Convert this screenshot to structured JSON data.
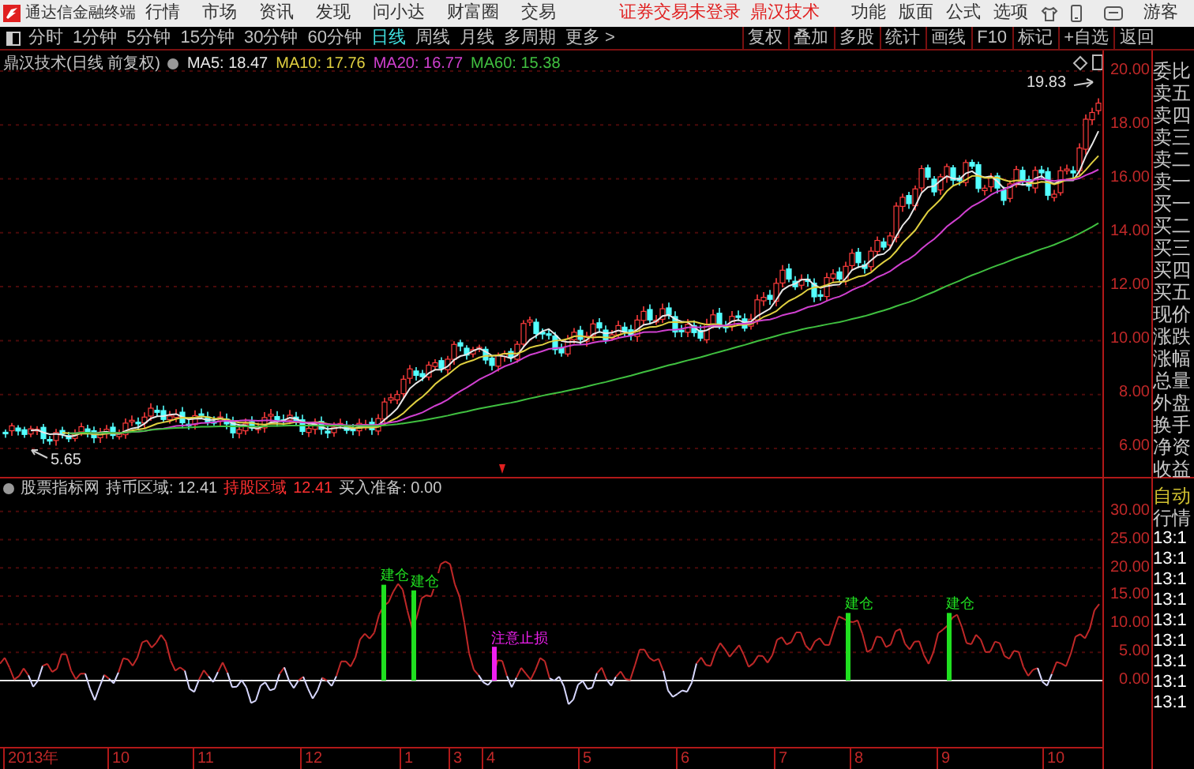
{
  "app": {
    "title": "通达信金融终端"
  },
  "menu": [
    "行情",
    "市场",
    "资讯",
    "发现",
    "问小达",
    "财富圈",
    "交易"
  ],
  "login_status": "证券交易未登录",
  "stock_name": "鼎汉技术",
  "right_menu": [
    "功能",
    "版面",
    "公式",
    "选项"
  ],
  "user": "游客",
  "periods": [
    {
      "label": "分时",
      "selected": false
    },
    {
      "label": "1分钟",
      "selected": false
    },
    {
      "label": "5分钟",
      "selected": false
    },
    {
      "label": "15分钟",
      "selected": false
    },
    {
      "label": "30分钟",
      "selected": false
    },
    {
      "label": "60分钟",
      "selected": false
    },
    {
      "label": "日线",
      "selected": true
    },
    {
      "label": "周线",
      "selected": false
    },
    {
      "label": "月线",
      "selected": false
    },
    {
      "label": "多周期",
      "selected": false
    }
  ],
  "more": "更多 >",
  "tools": [
    "复权",
    "叠加",
    "多股",
    "统计",
    "画线",
    "F10",
    "标记",
    "+自选",
    "返回"
  ],
  "chart": {
    "title": "鼎汉技术(日线 前复权)",
    "ma": [
      {
        "label": "MA5: 18.47",
        "color": "#e8e8e8"
      },
      {
        "label": "MA10: 17.76",
        "color": "#e0d040"
      },
      {
        "label": "MA20: 16.77",
        "color": "#d040d0"
      },
      {
        "label": "MA60: 15.38",
        "color": "#40c040"
      }
    ],
    "high_label": "19.83",
    "low_label": "5.65",
    "y_axis": [
      "20.00",
      "18.00",
      "16.00",
      "14.00",
      "12.00",
      "10.00",
      "8.00",
      "6.00"
    ]
  },
  "indicator": {
    "title": "股票指标网",
    "values": [
      {
        "label": "持币区域: 12.41",
        "color": "#c8c8c8"
      },
      {
        "label": "持股区域",
        "color": "#ff3030"
      },
      {
        "label": "12.41",
        "color": "#ff3030"
      },
      {
        "label": "买入准备: 0.00",
        "color": "#c8c8c8"
      }
    ],
    "signals": [
      {
        "label": "建仓",
        "kind": "buy"
      },
      {
        "label": "建仓",
        "kind": "buy"
      },
      {
        "label": "注意止损",
        "kind": "stop"
      },
      {
        "label": "建仓",
        "kind": "buy"
      },
      {
        "label": "建仓",
        "kind": "buy"
      }
    ],
    "y_axis": [
      "30.00",
      "25.00",
      "20.00",
      "15.00",
      "10.00",
      "5.00",
      "0.00"
    ]
  },
  "x_axis": [
    "2013年",
    "10",
    "11",
    "12",
    "1",
    "3",
    "4",
    "5",
    "6",
    "7",
    "8",
    "9",
    "10"
  ],
  "quote_panel": [
    "委比",
    "卖五",
    "卖四",
    "卖三",
    "卖二",
    "卖一",
    "买一",
    "买二",
    "买三",
    "买四",
    "买五",
    "现价",
    "涨跌",
    "涨幅",
    "总量",
    "外盘",
    "换手",
    "净资",
    "收益"
  ],
  "trade_panel": {
    "mode": "自动",
    "title": "行情",
    "times": [
      "13:1",
      "13:1",
      "13:1",
      "13:1",
      "13:1",
      "13:1",
      "13:1",
      "13:1",
      "13:1"
    ]
  }
}
